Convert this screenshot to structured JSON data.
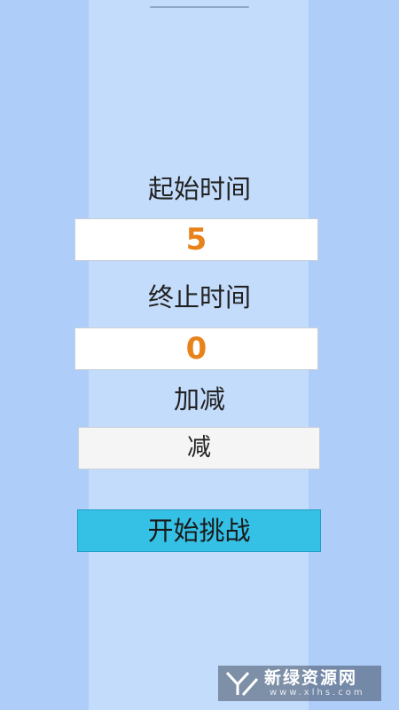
{
  "form": {
    "start_time_label": "起始时间",
    "start_time_value": "5",
    "end_time_label": "终止时间",
    "end_time_value": "0",
    "operation_label": "加减",
    "operation_value": "减",
    "start_button_label": "开始挑战"
  },
  "watermark": {
    "name": "新绿资源网",
    "url": "www.xlhs.com"
  },
  "colors": {
    "background": "#aecdf9",
    "center_strip": "#c4dcfb",
    "value_text": "#e8821a",
    "button": "#35c0e6"
  }
}
